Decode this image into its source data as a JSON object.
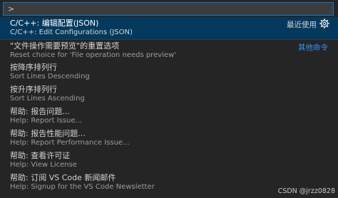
{
  "quick_input": {
    "value": ">",
    "placeholder": ""
  },
  "items": [
    {
      "label": "C/C++: 编辑配置(JSON)",
      "detail": "C/C++: Edit Configurations (JSON)",
      "right": "最近使用"
    },
    {
      "label": "\"文件操作需要预览\"的重置选项",
      "detail": "Reset choice for 'File operation needs preview'",
      "right": "其他命令"
    },
    {
      "label": "按降序排列行",
      "detail": "Sort Lines Descending"
    },
    {
      "label": "按升序排列行",
      "detail": "Sort Lines Ascending"
    },
    {
      "label": "帮助: 报告问题...",
      "detail": "Help: Report Issue..."
    },
    {
      "label": "帮助: 报告性能问题...",
      "detail": "Help: Report Performance Issue..."
    },
    {
      "label": "帮助: 查看许可证",
      "detail": "Help: View License"
    },
    {
      "label": "帮助: 订阅 VS Code 新闻邮件",
      "detail": "Help: Signup for the VS Code Newsletter"
    }
  ],
  "icons": {
    "configure": "gear-icon"
  },
  "watermark": "CSDN @jrzz0828",
  "colors": {
    "background": "#252526",
    "selection": "#04395e",
    "focus_border": "#007fd4",
    "link": "#3794ff"
  }
}
